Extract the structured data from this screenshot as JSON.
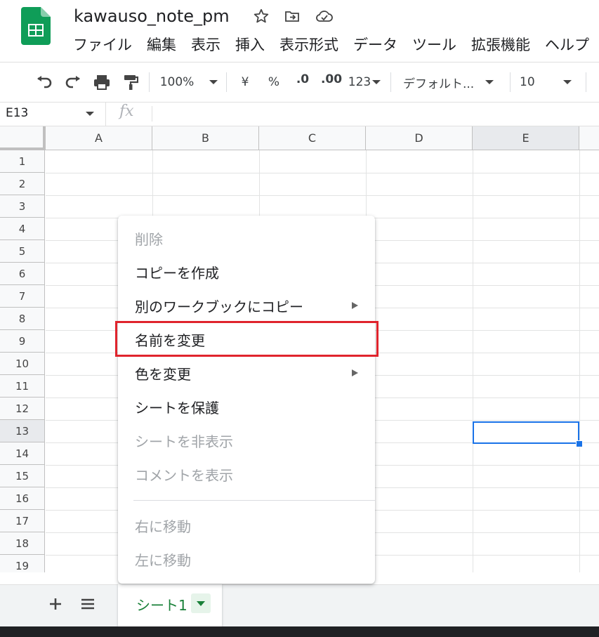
{
  "doc": {
    "title": "kawauso_note_pm"
  },
  "menu": [
    "ファイル",
    "編集",
    "表示",
    "挿入",
    "表示形式",
    "データ",
    "ツール",
    "拡張機能",
    "ヘルプ"
  ],
  "toolbar": {
    "zoom": "100%",
    "currency": "¥",
    "percent": "%",
    "dec_decrease": ".0",
    "dec_increase": ".00",
    "number_format": "123",
    "font": "デフォルト...",
    "font_size": "10"
  },
  "formula_bar": {
    "cell_ref": "E13",
    "fx": "fx"
  },
  "grid": {
    "columns": [
      "A",
      "B",
      "C",
      "D",
      "E"
    ],
    "rows": [
      "1",
      "2",
      "3",
      "4",
      "5",
      "6",
      "7",
      "8",
      "9",
      "10",
      "11",
      "12",
      "13",
      "14",
      "15",
      "16",
      "17",
      "18",
      "19"
    ],
    "selected_cell": "E13"
  },
  "context_menu": {
    "items": [
      {
        "label": "削除",
        "disabled": true,
        "submenu": false
      },
      {
        "label": "コピーを作成",
        "disabled": false,
        "submenu": false
      },
      {
        "label": "別のワークブックにコピー",
        "disabled": false,
        "submenu": true
      },
      {
        "label": "名前を変更",
        "disabled": false,
        "submenu": false,
        "highlighted": true
      },
      {
        "label": "色を変更",
        "disabled": false,
        "submenu": true
      },
      {
        "label": "シートを保護",
        "disabled": false,
        "submenu": false
      },
      {
        "label": "シートを非表示",
        "disabled": true,
        "submenu": false
      },
      {
        "label": "コメントを表示",
        "disabled": true,
        "submenu": false
      },
      {
        "label": "右に移動",
        "disabled": true,
        "submenu": false
      },
      {
        "label": "左に移動",
        "disabled": true,
        "submenu": false
      }
    ]
  },
  "sheet_tabs": [
    {
      "label": "シート1",
      "active": true
    }
  ],
  "colors": {
    "accent_green": "#188038",
    "selection_blue": "#1a73e8",
    "highlight_red": "#e0242d"
  },
  "icons": [
    "sheets-logo-icon",
    "star-icon",
    "move-to-folder-icon",
    "cloud-saved-icon",
    "undo-icon",
    "redo-icon",
    "print-icon",
    "paint-format-icon",
    "add-sheet-icon",
    "all-sheets-icon",
    "sheet-menu-caret-icon"
  ]
}
